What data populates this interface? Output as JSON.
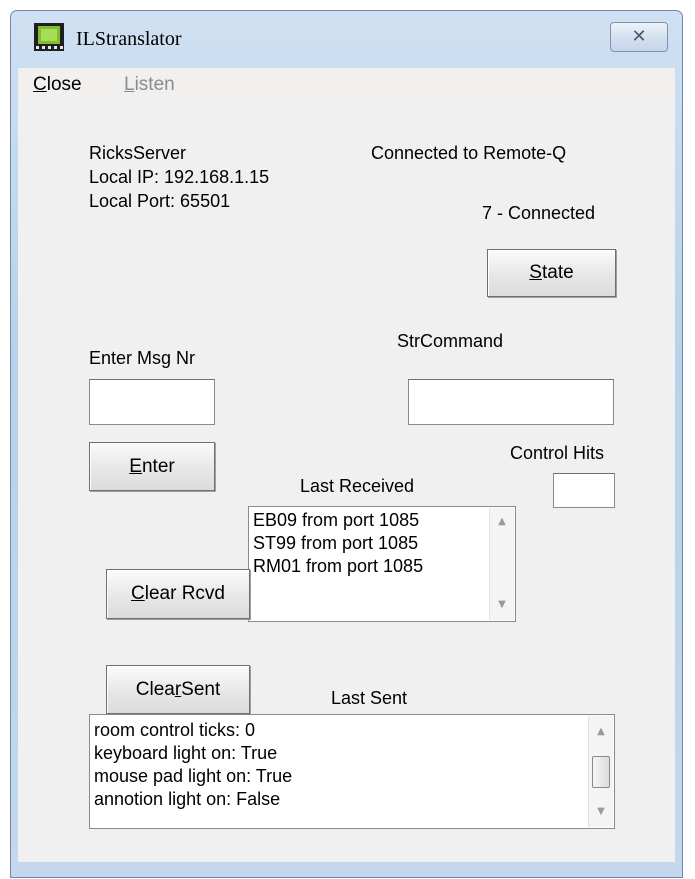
{
  "window": {
    "title": "ILStranslator",
    "close_glyph": "✕"
  },
  "menu": {
    "close": {
      "accel": "C",
      "rest": "lose"
    },
    "listen": {
      "accel": "L",
      "rest": "isten",
      "disabled": true
    }
  },
  "server": {
    "name": "RicksServer",
    "local_ip": "Local IP: 192.168.1.15",
    "local_port": "Local Port: 65501"
  },
  "connection": {
    "status": "Connected to Remote-Q",
    "state_text": "7 - Connected",
    "state_button": {
      "accel": "S",
      "rest": "tate"
    }
  },
  "msg_entry": {
    "label": "Enter Msg Nr",
    "value": "",
    "enter_button": {
      "accel": "E",
      "rest": "nter"
    }
  },
  "str_command": {
    "label": "StrCommand",
    "value": ""
  },
  "control_hits": {
    "label": "Control Hits",
    "value": ""
  },
  "received": {
    "label": "Last Received",
    "clear_button": {
      "pre": "",
      "accel": "C",
      "rest": "lear Rcvd"
    },
    "lines": [
      "EB09 from port 1085",
      "ST99 from port 1085",
      "RM01 from port 1085"
    ]
  },
  "sent": {
    "label": "Last Sent",
    "clear_button": {
      "pre": "Clea",
      "accel": "r",
      "rest": " Sent"
    },
    "lines": [
      "room control ticks: 0",
      "keyboard light on: True",
      "mouse pad light on: True",
      "annotion light on: False"
    ]
  },
  "icons": {
    "app": "film-frame-icon",
    "scroll_up": "▲",
    "scroll_down": "▼"
  },
  "colors": {
    "titlebar": "#b9d1ea",
    "client_bg": "#f0f0f0",
    "disabled_text": "#8c8c8c"
  }
}
